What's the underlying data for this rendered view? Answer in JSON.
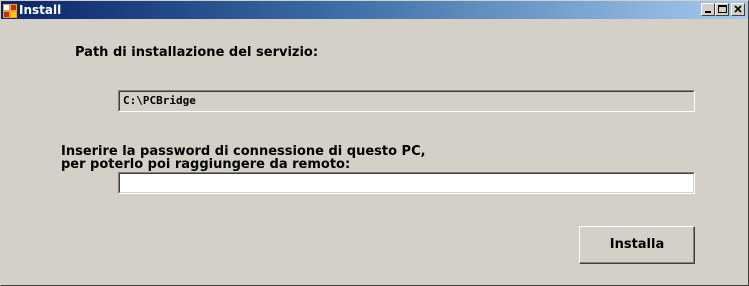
{
  "window": {
    "title": "Install",
    "app_icon": "pcbridge-app-icon",
    "controls": [
      "minimize-icon",
      "maximize-icon",
      "close-icon"
    ]
  },
  "form": {
    "path_label": "Path di installazione del servizio:",
    "path_value": "C:\\PCBridge",
    "password_label_line1": "Inserire la password di connessione di questo PC,",
    "password_label_line2": "per poterlo poi raggiungere da remoto:",
    "password_value": "",
    "install_button": "Installa"
  },
  "colors": {
    "title_bar_start": "#0a246a",
    "title_bar_end": "#a6caf0",
    "face": "#d4d0c8"
  }
}
